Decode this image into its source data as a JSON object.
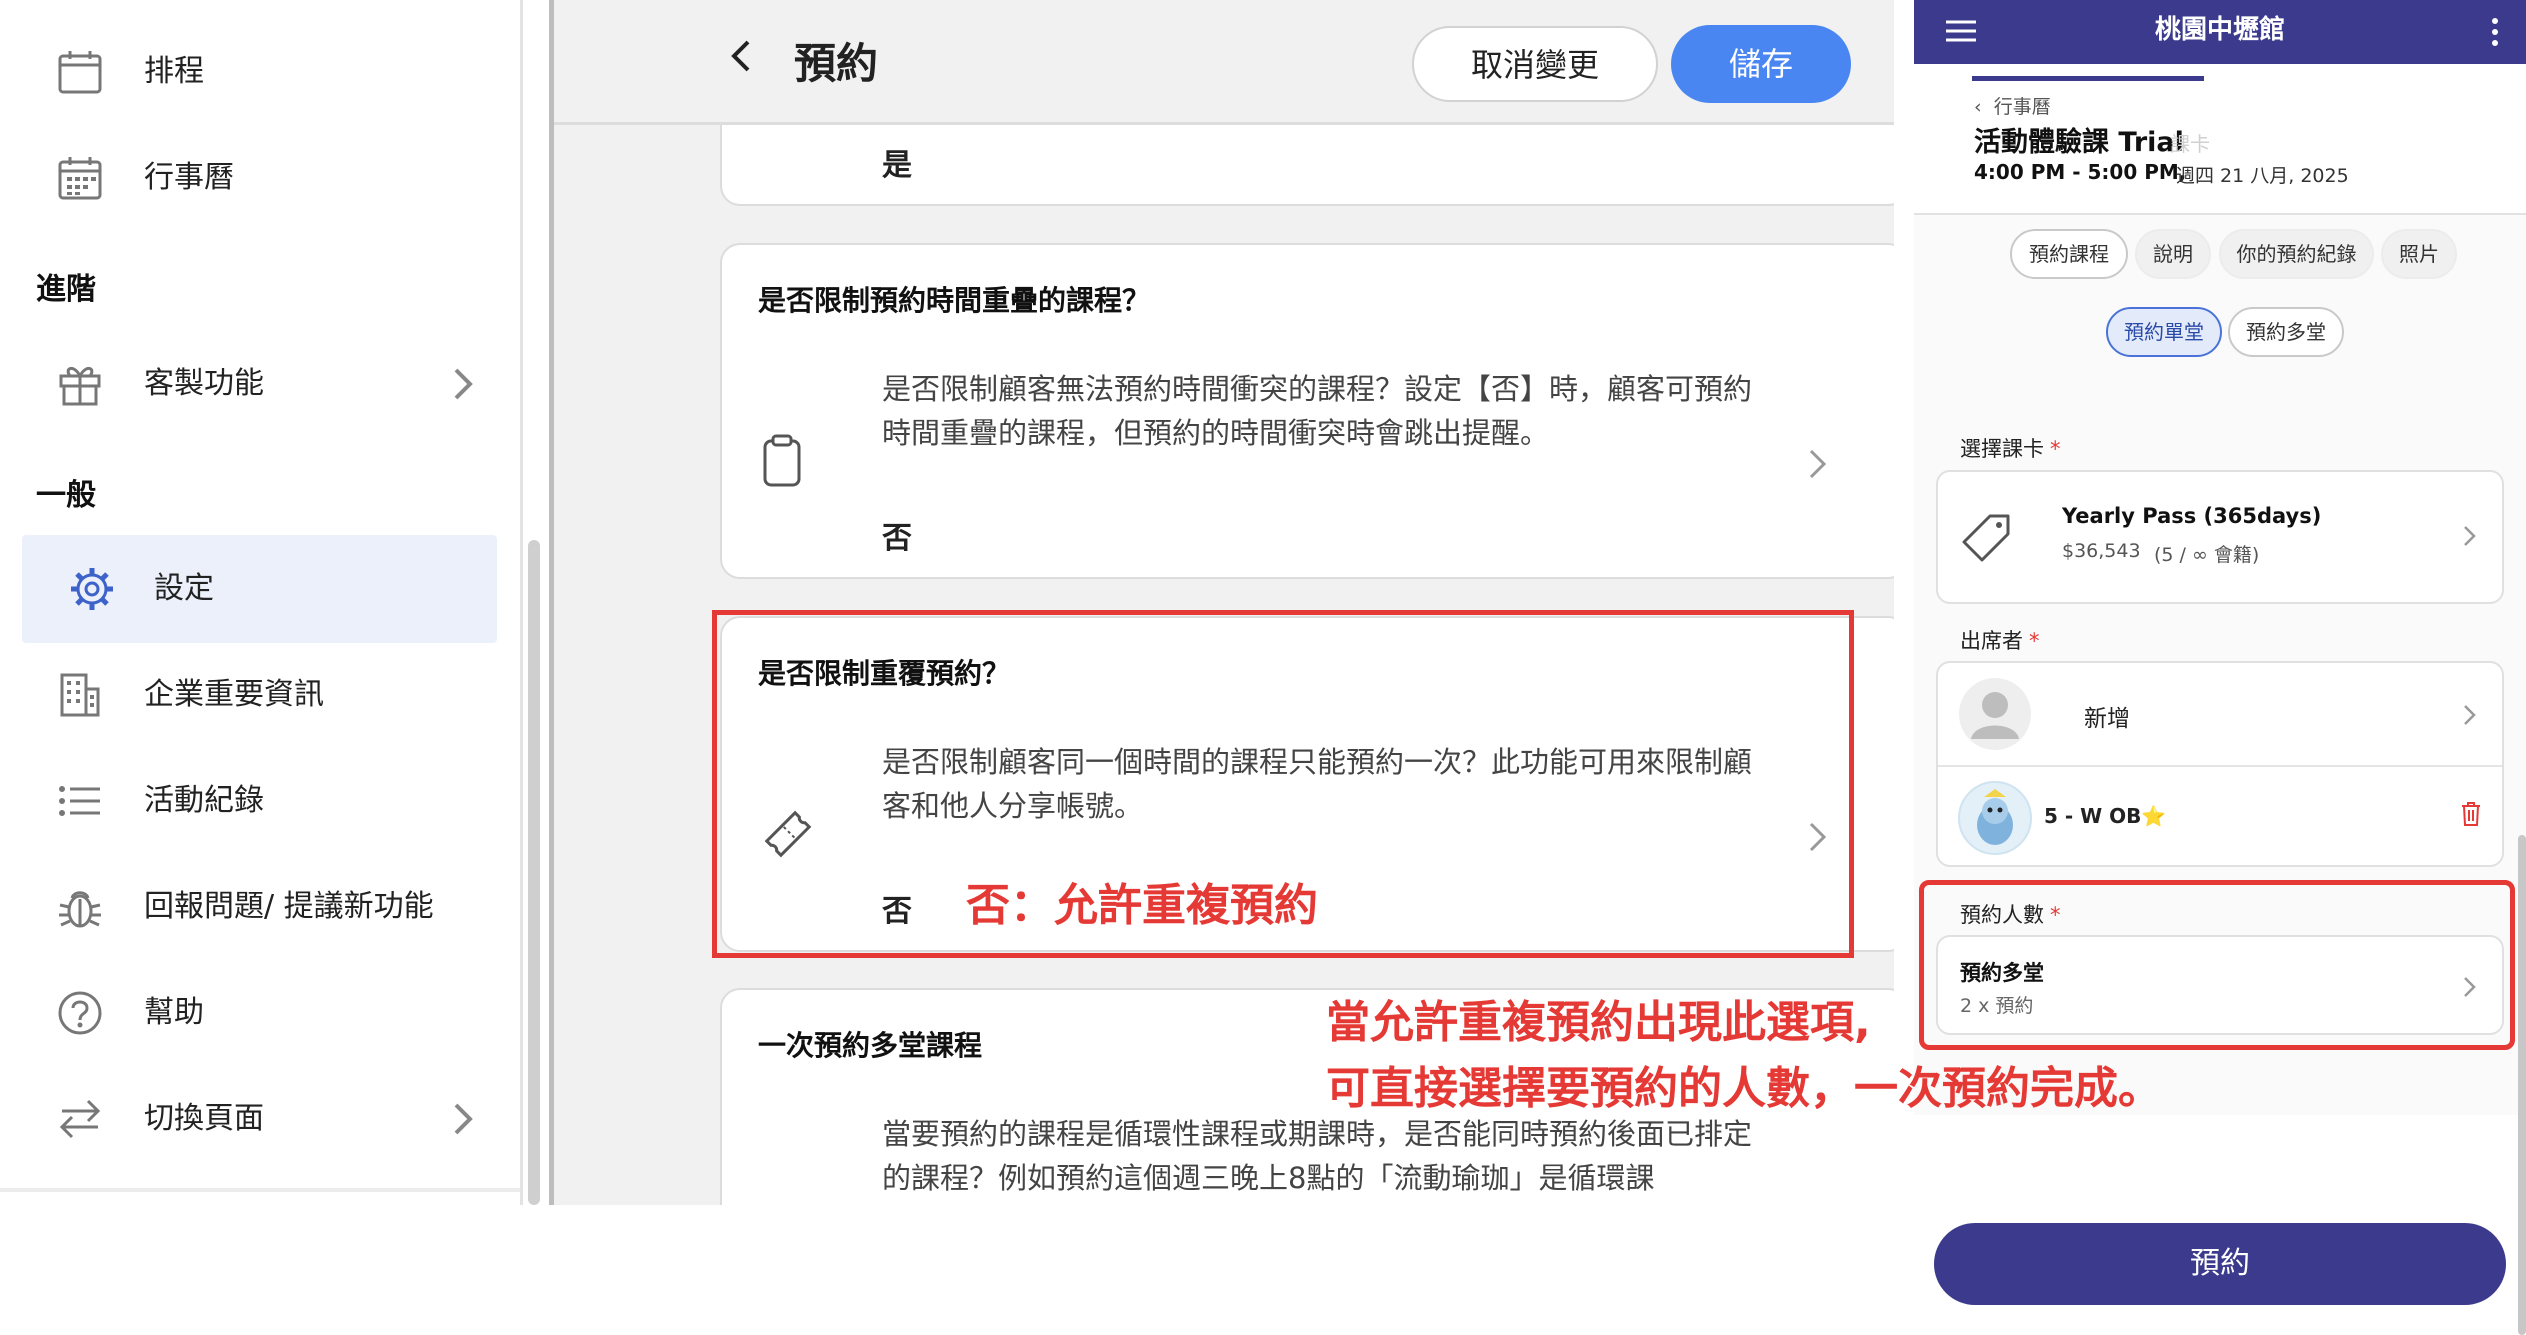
{
  "sidebar": {
    "items_top": [
      {
        "label": "排程",
        "icon": "calendar-icon"
      },
      {
        "label": "行事曆",
        "icon": "calendar-grid-icon"
      }
    ],
    "section_advanced": "進階",
    "custom_features": "客製功能",
    "section_general": "一般",
    "settings": "設定",
    "company_info": "企業重要資訊",
    "activity_log": "活動紀錄",
    "report_issue": "回報問題/ 提議新功能",
    "help": "幫助",
    "switch_page": "切換頁面"
  },
  "settings_panel": {
    "title": "預約",
    "cancel_label": "取消變更",
    "save_label": "儲存",
    "partial_card_value": "是",
    "cards": [
      {
        "title": "是否限制預約時間重疊的課程？",
        "description": "是否限制顧客無法預約時間衝突的課程？設定【否】時，顧客可預約時間重疊的課程，但預約的時間衝突時會跳出提醒。",
        "value": "否",
        "icon": "clipboard-icon"
      },
      {
        "title": "是否限制重覆預約？",
        "description": "是否限制顧客同一個時間的課程只能預約一次？此功能可用來限制顧客和他人分享帳號。",
        "value": "否",
        "icon": "ticket-icon"
      },
      {
        "title": "一次預約多堂課程",
        "description": "當要預約的課程是循環性課程或期課時，是否能同時預約後面已排定的課程？例如預約這個週三晚上8點的「流動瑜珈」是循環課",
        "icon": "repeat-icon"
      }
    ]
  },
  "annotations": {
    "note_allow_repeat": "否：允許重複預約",
    "note_quantity_line1": "當允許重複預約出現此選項,",
    "note_quantity_line2": "可直接選擇要預約的人數，一次預約完成。",
    "color": "#e53935"
  },
  "phone": {
    "app_title": "桃園中壢館",
    "breadcrumb": "行事曆",
    "event_title": "活動體驗課 Trial",
    "event_title_ghost": "課卡",
    "event_time": "4:00 PM - 5:00 PM,",
    "event_date": "週四 21 八月, 2025",
    "tabs": [
      "預約課程",
      "說明",
      "你的預約紀錄",
      "照片"
    ],
    "book_modes": [
      "預約單堂",
      "預約多堂"
    ],
    "card_label": "選擇課卡",
    "pass_name": "Yearly Pass (365days)",
    "pass_price": "$36,543",
    "pass_usage": "(5 / ∞  會籍)",
    "attendee_label": "出席者",
    "add_attendee": "新增",
    "attendee_name": "5 - W OB⭐",
    "quantity_label": "預約人數",
    "quantity_title": "預約多堂",
    "quantity_value": "2 x 預約",
    "book_button": "預約"
  },
  "colors": {
    "brand_dark": "#3b3a8c",
    "save_blue": "#4a86f2",
    "highlight_bg": "#ebf0fa"
  }
}
